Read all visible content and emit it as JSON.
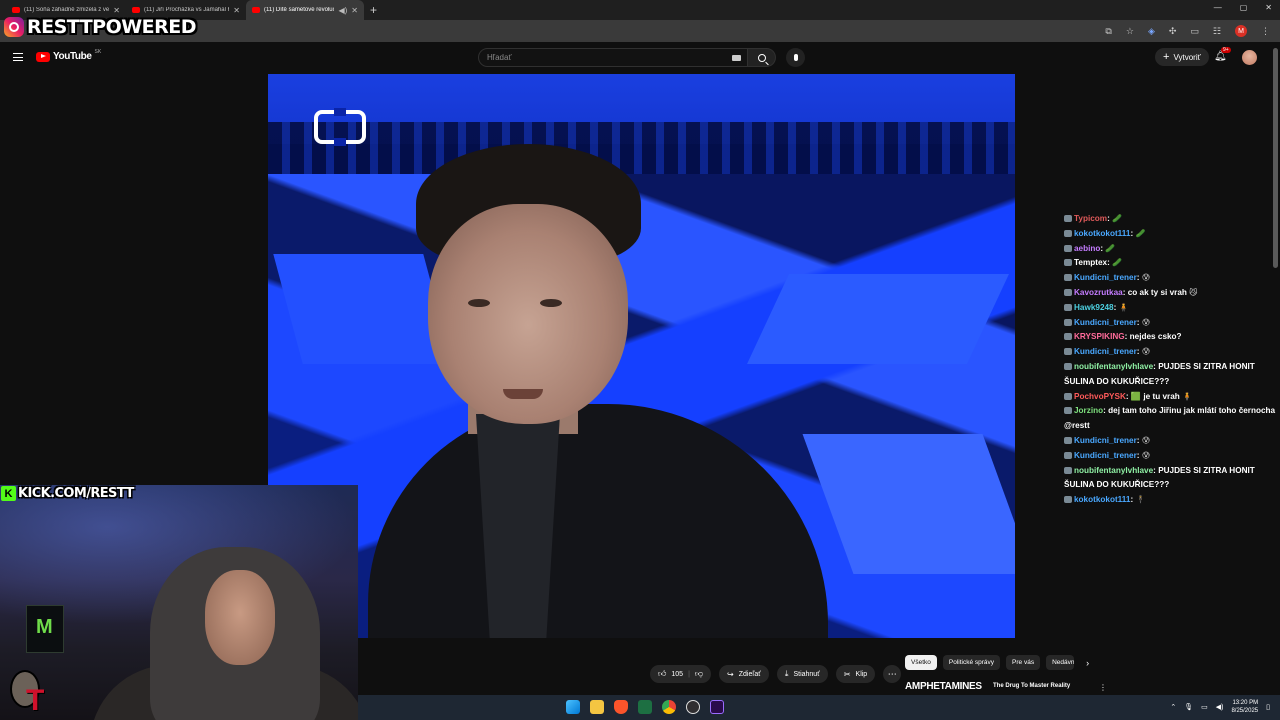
{
  "browser": {
    "tabs": [
      {
        "title": "(11) Soňa záhadně zmizela z vesnice"
      },
      {
        "title": "(11) Jiří Procházka vs Jamahal Hill"
      },
      {
        "title": "(11) Dítě sametové revoluce"
      }
    ],
    "address_fragment": "undSeo",
    "window_controls": [
      "—",
      "▢",
      "✕"
    ]
  },
  "overlay": {
    "brand": "RESTTPOWERED",
    "kick": "KICK.COM/RESTT"
  },
  "youtube": {
    "logo": "YouTube",
    "country": "SK",
    "search_placeholder": "Hľadať",
    "create_label": "Vytvoriť",
    "notifications": "9+"
  },
  "video_actions": {
    "likes": "105",
    "share": "Zdieľať",
    "download": "Stiahnuť",
    "clip": "Klip"
  },
  "chips": [
    "Všetko",
    "Politické správy",
    "Pre vás",
    "Nedávno"
  ],
  "recommended": {
    "title_big": "AMPHETAMINES",
    "title_small": "The Drug To Master Reality"
  },
  "chat": [
    {
      "user": "Typicom",
      "color": "#e05a5a",
      "text": "",
      "emote": "🥒"
    },
    {
      "user": "kokotkokot111",
      "color": "#4aa8ff",
      "text": "",
      "emote": "🥒"
    },
    {
      "user": "aebino",
      "color": "#c47cff",
      "text": "",
      "emote": "🥒"
    },
    {
      "user": "Temptex",
      "color": "#ffffff",
      "text": "",
      "emote": "🥒"
    },
    {
      "user": "Kundicni_trener",
      "color": "#4aa8ff",
      "text": "",
      "emote": "😰"
    },
    {
      "user": "Kavozrutkaa",
      "color": "#c47cff",
      "text": "co ak ty si vrah",
      "emote": "😼"
    },
    {
      "user": "Hawk9248",
      "color": "#4dd0e1",
      "text": "",
      "emote": "🧍"
    },
    {
      "user": "Kundicni_trener",
      "color": "#4aa8ff",
      "text": "",
      "emote": "😰"
    },
    {
      "user": "KRYSPIKING",
      "color": "#ff6b9a",
      "text": "nejdes csko?",
      "emote": ""
    },
    {
      "user": "Kundicni_trener",
      "color": "#4aa8ff",
      "text": "",
      "emote": "😰"
    },
    {
      "user": "noubifentanylvhlave",
      "color": "#8ff0a4",
      "text": "PUJDES SI ZITRA HONIT ŠULINA DO KUKUŘICE???",
      "emote": ""
    },
    {
      "user": "PochvoPYSK",
      "color": "#ff5a5a",
      "text": "🟩 je tu vrah",
      "emote": "🧍"
    },
    {
      "user": "Jorzino",
      "color": "#7ee07e",
      "text": "dej tam toho Jiřinu jak mlátí toho černocha @restt",
      "emote": ""
    },
    {
      "user": "Kundicni_trener",
      "color": "#4aa8ff",
      "text": "",
      "emote": "😰"
    },
    {
      "user": "Kundicni_trener",
      "color": "#4aa8ff",
      "text": "",
      "emote": "😰"
    },
    {
      "user": "noubifentanylvhlave",
      "color": "#8ff0a4",
      "text": "PUJDES SI ZITRA HONIT ŠULINA DO KUKUŘICE???",
      "emote": ""
    },
    {
      "user": "kokotkokot111",
      "color": "#4aa8ff",
      "text": "",
      "emote": "🕴"
    }
  ],
  "taskbar": {
    "time": "13:20 PM",
    "date": "8/25/2025"
  }
}
